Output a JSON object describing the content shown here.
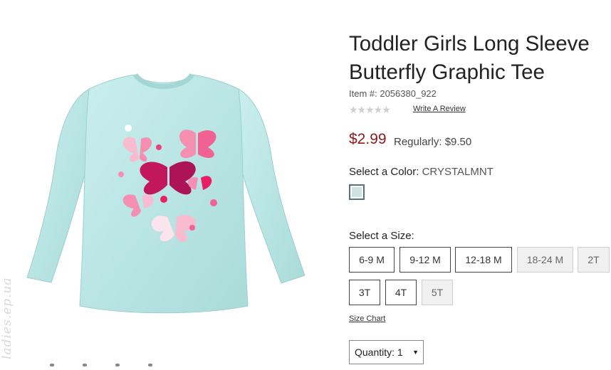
{
  "product": {
    "title_line1": "Toddler Girls Long Sleeve",
    "title_line2": "Butterfly Graphic Tee",
    "item_number": "Item #: 2056380_922",
    "rating_stars": "★★★★★",
    "write_review": "Write A Review",
    "sale_price": "$2.99",
    "regular_price": "Regularly: $9.50"
  },
  "color": {
    "label": "Select a Color:",
    "selected": "CRYSTALMNT",
    "swatch_color": "#cfe2e4"
  },
  "size": {
    "label": "Select a Size:",
    "options": [
      "6-9 M",
      "9-12 M",
      "12-18 M",
      "18-24 M",
      "2T",
      "3T",
      "4T",
      "5T"
    ],
    "unavailable": [
      "18-24 M",
      "2T",
      "5T"
    ],
    "size_chart": "Size Chart"
  },
  "quantity": {
    "label": "Quantity:",
    "value": "1"
  },
  "watermark": "ladies.ep.ua",
  "colors": {
    "price": "#8b1a1a",
    "shirt": "#bfe8e6",
    "butterfly_dark": "#c2185b",
    "butterfly_light": "#f48fb1"
  }
}
